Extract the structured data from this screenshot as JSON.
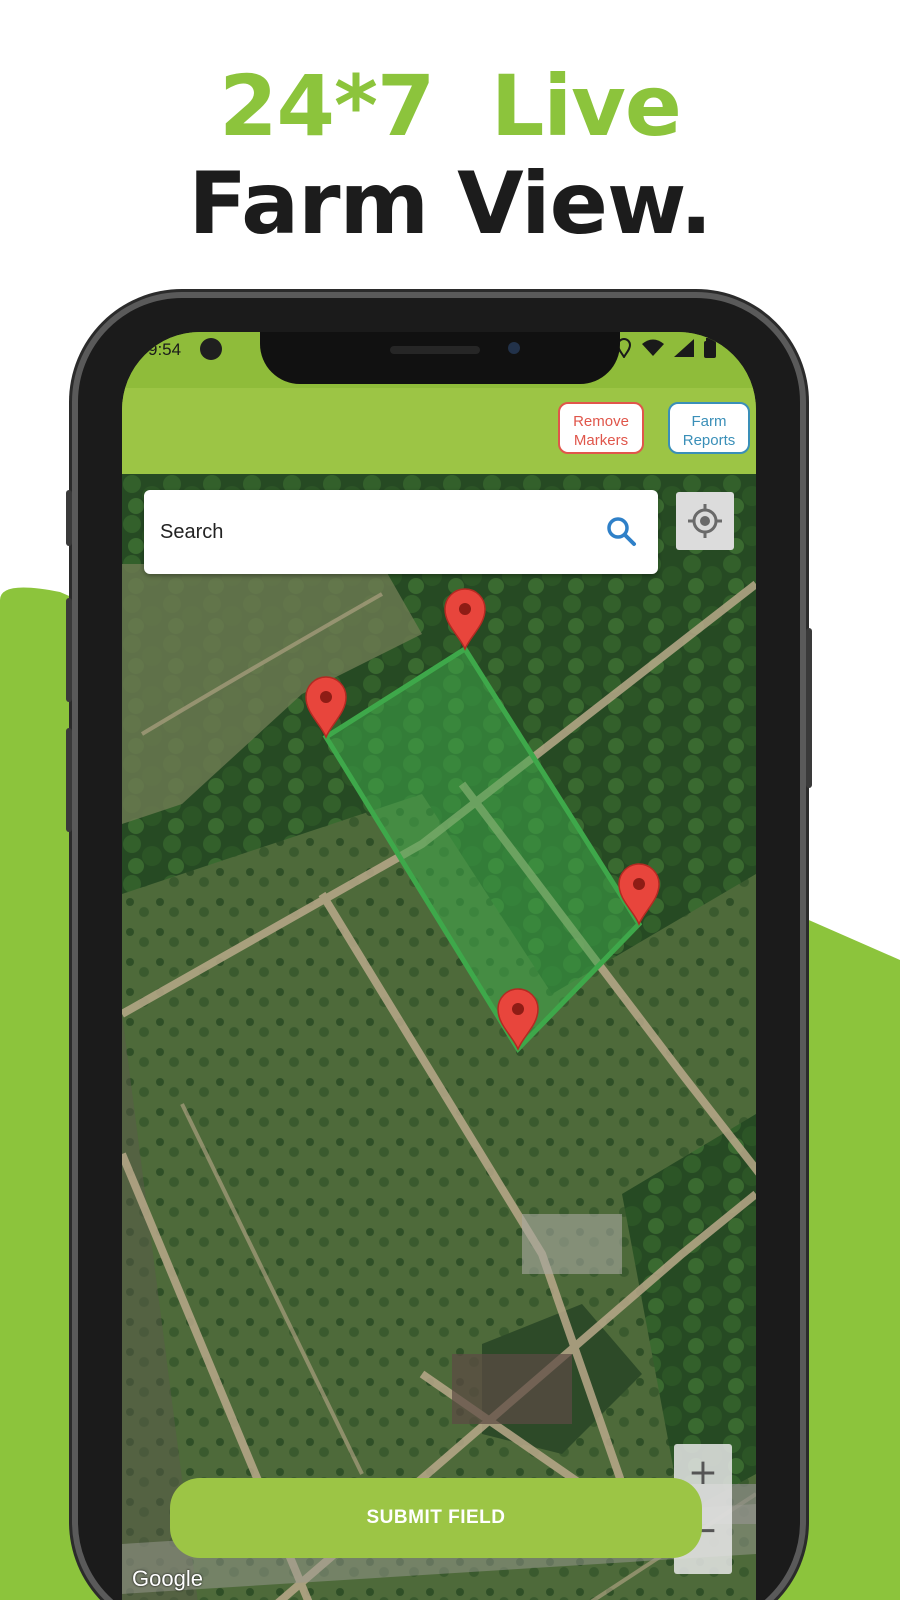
{
  "headline": {
    "line1": "24*7  Live",
    "line2": "Farm View."
  },
  "colors": {
    "brand_green": "#8cc43c",
    "appbar_green": "#9cc545",
    "remove_red": "#e0564b",
    "reports_blue": "#3a8fb8",
    "polygon_green": "#3ea84a",
    "marker_red": "#e8453c"
  },
  "status_bar": {
    "time": "9:54",
    "icons": [
      "phone-call-icon",
      "location-icon",
      "wifi-icon",
      "signal-icon",
      "battery-icon"
    ]
  },
  "appbar": {
    "remove_markers": {
      "line1": "Remove",
      "line2": "Markers"
    },
    "farm_reports": {
      "line1": "Farm",
      "line2": "Reports"
    }
  },
  "search": {
    "placeholder": "Search",
    "icon": "search-icon"
  },
  "locate": {
    "icon": "my-location-icon"
  },
  "zoom": {
    "plus": "+",
    "minus": "−"
  },
  "submit": {
    "label": "SUBMIT FIELD"
  },
  "attribution": "Google",
  "markers": {
    "icon": "map-pin-icon",
    "count": 4
  }
}
